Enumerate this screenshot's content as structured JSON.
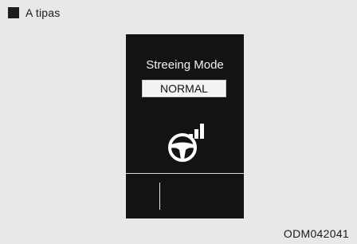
{
  "caption": {
    "text": "A tipas"
  },
  "display": {
    "title": "Streeing Mode",
    "mode_value": "NORMAL",
    "icon": "steering-wheel-level-icon"
  },
  "figure_code": "ODM042041"
}
